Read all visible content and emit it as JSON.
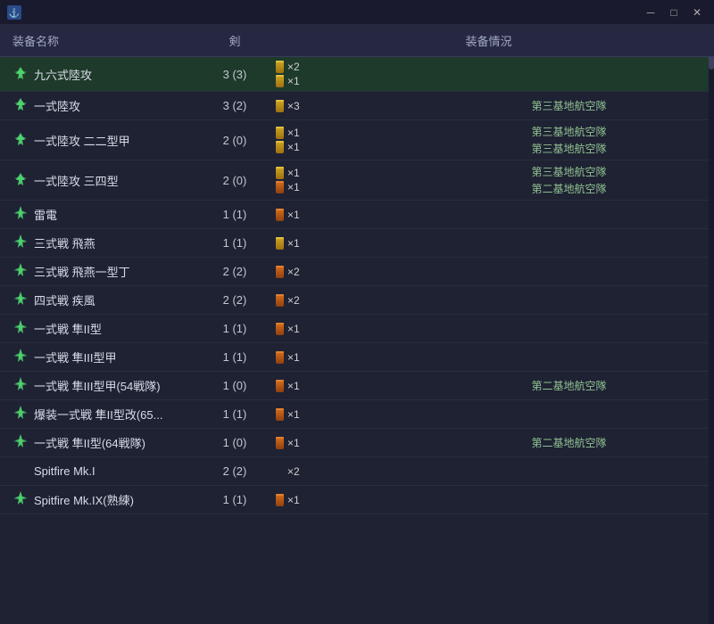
{
  "titlebar": {
    "minimize_label": "─",
    "maximize_label": "□",
    "close_label": "✕"
  },
  "header": {
    "col1": "装备名称",
    "col2": "剣",
    "col3": "装备情況"
  },
  "rows": [
    {
      "id": "row-1",
      "name": "九六式陸攻",
      "count": "3 (3)",
      "items": [
        {
          "type": "yellow",
          "count": "×2"
        },
        {
          "type": "yellow",
          "count": "×1"
        }
      ],
      "locations": [],
      "highlighted": true,
      "icon_type": "bomber"
    },
    {
      "id": "row-2",
      "name": "一式陸攻",
      "count": "3 (2)",
      "items": [
        {
          "type": "yellow",
          "count": "×3"
        }
      ],
      "locations": [
        "第三基地航空隊"
      ],
      "highlighted": false,
      "icon_type": "bomber"
    },
    {
      "id": "row-3",
      "name": "一式陸攻 二二型甲",
      "count": "2 (0)",
      "items": [
        {
          "type": "yellow",
          "count": "×1"
        },
        {
          "type": "yellow",
          "count": "×1"
        }
      ],
      "locations": [
        "第三基地航空隊",
        "第三基地航空隊"
      ],
      "highlighted": false,
      "icon_type": "bomber"
    },
    {
      "id": "row-4",
      "name": "一式陸攻 三四型",
      "count": "2 (0)",
      "items": [
        {
          "type": "yellow",
          "count": "×1"
        },
        {
          "type": "orange",
          "count": "×1"
        }
      ],
      "locations": [
        "第三基地航空隊",
        "第二基地航空隊"
      ],
      "highlighted": false,
      "icon_type": "bomber"
    },
    {
      "id": "row-5",
      "name": "雷電",
      "count": "1 (1)",
      "items": [
        {
          "type": "orange",
          "count": "×1"
        }
      ],
      "locations": [],
      "highlighted": false,
      "icon_type": "fighter"
    },
    {
      "id": "row-6",
      "name": "三式戦 飛燕",
      "count": "1 (1)",
      "items": [
        {
          "type": "yellow",
          "count": "×1"
        }
      ],
      "locations": [],
      "highlighted": false,
      "icon_type": "fighter"
    },
    {
      "id": "row-7",
      "name": "三式戦 飛燕一型丁",
      "count": "2 (2)",
      "items": [
        {
          "type": "orange",
          "count": "×2"
        }
      ],
      "locations": [],
      "highlighted": false,
      "icon_type": "fighter"
    },
    {
      "id": "row-8",
      "name": "四式戦 疾風",
      "count": "2 (2)",
      "items": [
        {
          "type": "orange",
          "count": "×2"
        }
      ],
      "locations": [],
      "highlighted": false,
      "icon_type": "fighter"
    },
    {
      "id": "row-9",
      "name": "一式戦 隼II型",
      "count": "1 (1)",
      "items": [
        {
          "type": "orange",
          "count": "×1"
        }
      ],
      "locations": [],
      "highlighted": false,
      "icon_type": "fighter"
    },
    {
      "id": "row-10",
      "name": "一式戦 隼III型甲",
      "count": "1 (1)",
      "items": [
        {
          "type": "orange",
          "count": "×1"
        }
      ],
      "locations": [],
      "highlighted": false,
      "icon_type": "fighter"
    },
    {
      "id": "row-11",
      "name": "一式戦 隼III型甲(54戦隊)",
      "count": "1 (0)",
      "items": [
        {
          "type": "orange",
          "count": "×1"
        }
      ],
      "locations": [
        "第二基地航空隊"
      ],
      "highlighted": false,
      "icon_type": "fighter"
    },
    {
      "id": "row-12",
      "name": "爆装一式戦 隼II型改(65...",
      "count": "1 (1)",
      "items": [
        {
          "type": "orange",
          "count": "×1"
        }
      ],
      "locations": [],
      "highlighted": false,
      "icon_type": "fighter"
    },
    {
      "id": "row-13",
      "name": "一式戦 隼II型(64戦隊)",
      "count": "1 (0)",
      "items": [
        {
          "type": "orange",
          "count": "×1"
        }
      ],
      "locations": [
        "第二基地航空隊"
      ],
      "highlighted": false,
      "icon_type": "fighter"
    },
    {
      "id": "row-14",
      "name": "Spitfire Mk.I",
      "count": "2 (2)",
      "items": [
        {
          "type": "none",
          "count": "×2"
        }
      ],
      "locations": [],
      "highlighted": false,
      "icon_type": "spitfire"
    },
    {
      "id": "row-15",
      "name": "Spitfire Mk.IX(熟練)",
      "count": "1 (1)",
      "items": [
        {
          "type": "orange",
          "count": "×1"
        }
      ],
      "locations": [],
      "highlighted": false,
      "icon_type": "spitfire2"
    }
  ]
}
